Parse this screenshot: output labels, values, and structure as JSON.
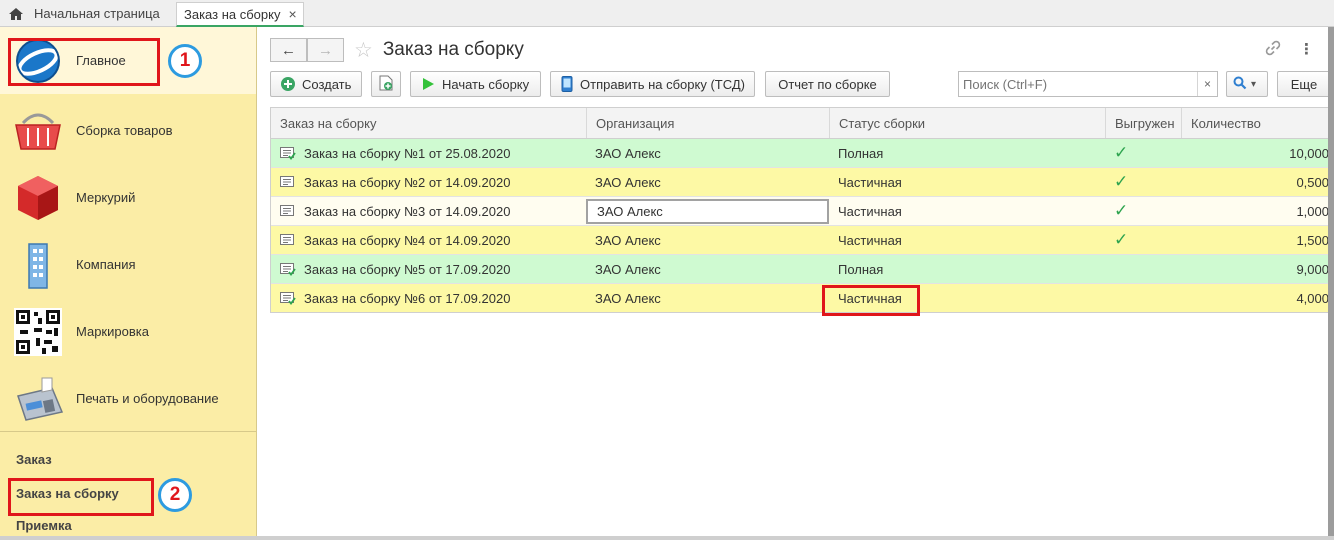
{
  "tabs": {
    "home": "Начальная страница",
    "active": "Заказ на сборку",
    "close": "×"
  },
  "sidebar": {
    "sections": [
      {
        "label": "Главное",
        "icon": "globe-logo-icon"
      },
      {
        "label": "Сборка товаров",
        "icon": "basket-icon"
      },
      {
        "label": "Меркурий",
        "icon": "red-cube-icon"
      },
      {
        "label": "Компания",
        "icon": "building-icon"
      },
      {
        "label": "Маркировка",
        "icon": "qr-code-icon"
      },
      {
        "label": "Печать и оборудование",
        "icon": "cash-register-icon"
      }
    ],
    "links": [
      "Заказ",
      "Заказ на сборку",
      "Приемка"
    ]
  },
  "annotations": {
    "badge1": "1",
    "badge2": "2"
  },
  "header": {
    "back": "←",
    "forward": "→",
    "star": "☆",
    "title": "Заказ на сборку",
    "link_icon": "link-icon",
    "more": "⋮"
  },
  "toolbar": {
    "create": "Создать",
    "start": "Начать сборку",
    "send": "Отправить на сборку (ТСД)",
    "report": "Отчет по сборке",
    "search_placeholder": "Поиск (Ctrl+F)",
    "clear": "×",
    "search_dropdown": "▾",
    "more": "Еще"
  },
  "table": {
    "columns": [
      "Заказ на сборку",
      "Организация",
      "Статус сборки",
      "Выгружен",
      "Количество"
    ],
    "rows": [
      {
        "order": "Заказ на сборку №1 от 25.08.2020",
        "org": "ЗАО Алекс",
        "status": "Полная",
        "exported": "✓",
        "qty": "10,000",
        "style": "green"
      },
      {
        "order": "Заказ на сборку №2 от 14.09.2020",
        "org": "ЗАО Алекс",
        "status": "Частичная",
        "exported": "✓",
        "qty": "0,500",
        "style": "yellow"
      },
      {
        "order": "Заказ на сборку №3 от 14.09.2020",
        "org": "ЗАО Алекс",
        "status": "Частичная",
        "exported": "✓",
        "qty": "1,000",
        "style": "light"
      },
      {
        "order": "Заказ на сборку №4 от 14.09.2020",
        "org": "ЗАО Алекс",
        "status": "Частичная",
        "exported": "✓",
        "qty": "1,500",
        "style": "yellow"
      },
      {
        "order": "Заказ на сборку №5 от 17.09.2020",
        "org": "ЗАО Алекс",
        "status": "Полная",
        "exported": "",
        "qty": "9,000",
        "style": "green"
      },
      {
        "order": "Заказ на сборку №6 от 17.09.2020",
        "org": "ЗАО Алекс",
        "status": "Частичная",
        "exported": "",
        "qty": "4,000",
        "style": "yellow"
      }
    ]
  },
  "colors": {
    "accent_green": "#3aa564",
    "highlight_red": "#e0161b",
    "badge_blue": "#2d9be0"
  }
}
